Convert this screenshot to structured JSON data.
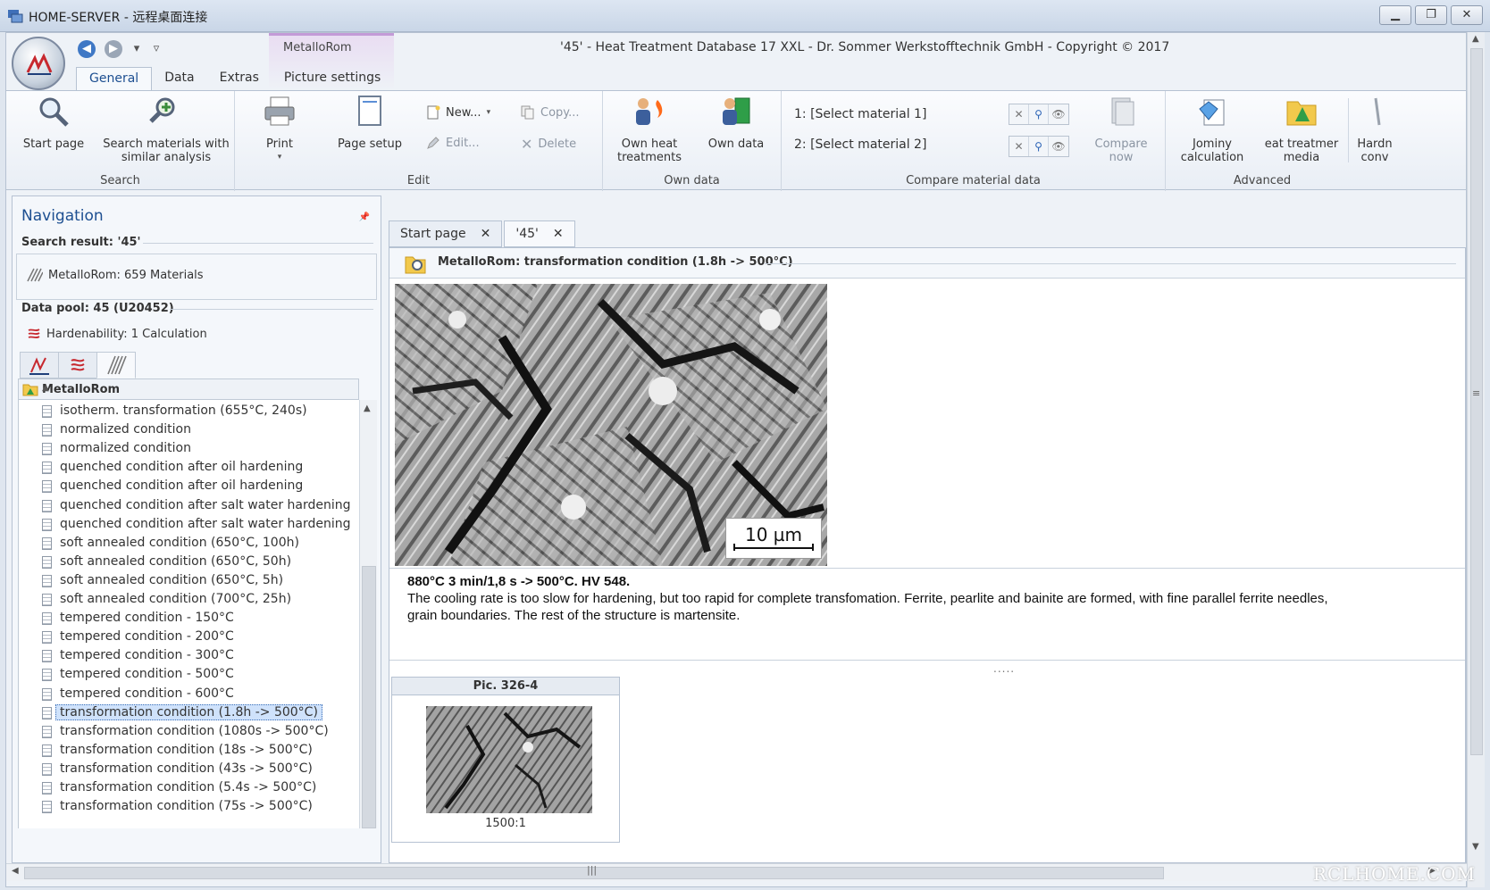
{
  "rdp": {
    "title": "HOME-SERVER - 远程桌面连接",
    "minimize": "▁",
    "restore": "❐",
    "close": "✕"
  },
  "app": {
    "title": "'45' - Heat Treatment Database 17 XXL - Dr. Sommer Werkstofftechnik GmbH - Copyright © 2017",
    "context_tab": "MetalloRom",
    "tabs": [
      {
        "label": "General",
        "active": true
      },
      {
        "label": "Data"
      },
      {
        "label": "Extras"
      },
      {
        "label": "Picture settings"
      }
    ]
  },
  "ribbon": {
    "search": {
      "label": "Search",
      "start_page": "Start page",
      "similar_line1": "Search materials with",
      "similar_line2": "similar analysis"
    },
    "edit": {
      "label": "Edit",
      "print": "Print",
      "page_setup": "Page setup",
      "new": "New...",
      "copy": "Copy...",
      "edit_item": "Edit...",
      "delete": "Delete"
    },
    "own_data": {
      "label": "Own data",
      "heat_line1": "Own heat",
      "heat_line2": "treatments",
      "own": "Own data"
    },
    "compare": {
      "label": "Compare material data",
      "m1": "1:  [Select material 1]",
      "m2": "2:  [Select material 2]",
      "now_line1": "Compare",
      "now_line2": "now"
    },
    "advanced": {
      "label": "Advanced",
      "jominy_line1": "Jominy",
      "jominy_line2": "calculation",
      "media_line1": "eat treatmer",
      "media_line2": "media",
      "hard_line1": "Hardn",
      "hard_line2": "conv"
    }
  },
  "nav": {
    "title": "Navigation",
    "search_result": "Search result: '45'",
    "metallorom_count": "MetalloRom: 659 Materials",
    "data_pool": "Data pool: 45 (U20452)",
    "hardenability": "Hardenability: 1 Calculation",
    "tree_root": "MetalloRom",
    "items": [
      "isotherm. transformation (655°C, 240s)",
      "normalized condition",
      "normalized condition",
      "quenched condition after oil hardening",
      "quenched condition after oil hardening",
      "quenched condition after salt water hardening",
      "quenched condition after salt water hardening",
      "soft annealed condition (650°C, 100h)",
      "soft annealed condition (650°C, 50h)",
      "soft annealed condition (650°C, 5h)",
      "soft annealed condition (700°C, 25h)",
      "tempered condition - 150°C",
      "tempered condition - 200°C",
      "tempered condition - 300°C",
      "tempered condition - 500°C",
      "tempered condition - 600°C",
      "transformation condition (1.8h -> 500°C)",
      "transformation condition (1080s -> 500°C)",
      "transformation condition (18s -> 500°C)",
      "transformation condition (43s -> 500°C)",
      "transformation condition (5.4s -> 500°C)",
      "transformation condition (75s -> 500°C)"
    ],
    "selected_index": 16
  },
  "doc": {
    "tabs": [
      {
        "label": "Start page"
      },
      {
        "label": "'45'",
        "active": true
      }
    ],
    "tab_close": "✕",
    "header": "MetalloRom: transformation condition (1.8h -> 500°C)",
    "scale": "10 µm",
    "caption_bold": "880°C 3 min/1,8 s -> 500°C. HV 548.",
    "caption_line1": "The cooling rate is too slow for hardening, but too rapid for complete transfomation. Ferrite, pearlite and bainite are formed, with fine parallel ferrite needles,",
    "caption_line2": "grain boundaries. The rest of the structure is martensite.",
    "splitter": ".....",
    "thumb_title": "Pic. 326-4",
    "thumb_mag": "1500:1"
  },
  "watermark": "RCLHOME.COM",
  "colors": {
    "accent": "#1d4f91",
    "selection": "#cfe2fb",
    "context": "#c39ad7"
  }
}
